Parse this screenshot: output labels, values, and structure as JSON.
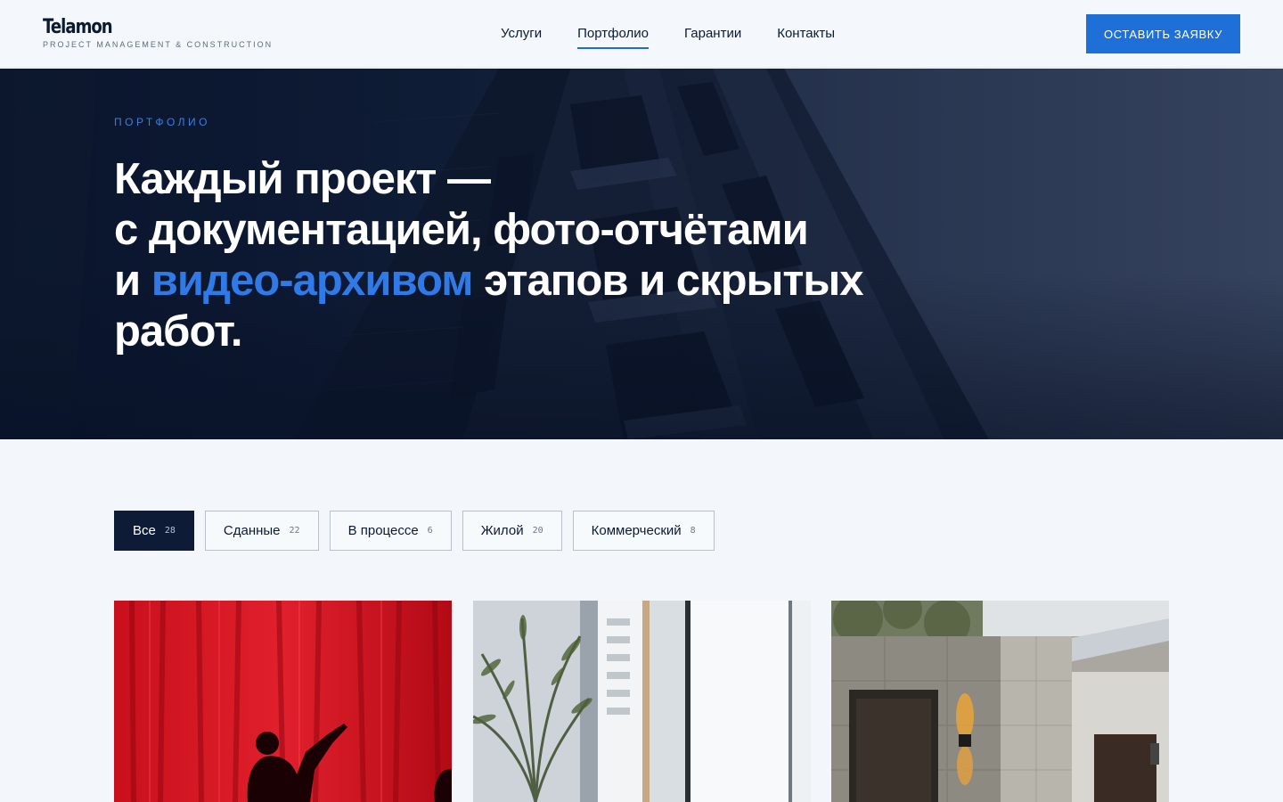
{
  "brand": {
    "name": "Telamon",
    "tagline": "PROJECT MANAGEMENT & CONSTRUCTION"
  },
  "nav": {
    "items": [
      {
        "label": "Услуги",
        "active": false
      },
      {
        "label": "Портфолио",
        "active": true
      },
      {
        "label": "Гарантии",
        "active": false
      },
      {
        "label": "Контакты",
        "active": false
      }
    ],
    "cta_label": "ОСТАВИТЬ ЗАЯВКУ"
  },
  "hero": {
    "eyebrow": "ПОРТФОЛИО",
    "title_line1": "Каждый проект —",
    "title_line2": "с документацией, фото-отчётами",
    "title_line3_start": "и ",
    "title_accent": "видео-архивом",
    "title_line3_end": " этапов и скрытых",
    "title_line4": "работ."
  },
  "filters": [
    {
      "label": "Все",
      "count": "28",
      "active": true
    },
    {
      "label": "Сданные",
      "count": "22",
      "active": false
    },
    {
      "label": "В процессе",
      "count": "6",
      "active": false
    },
    {
      "label": "Жилой",
      "count": "20",
      "active": false
    },
    {
      "label": "Коммерческий",
      "count": "8",
      "active": false
    }
  ],
  "colors": {
    "accent": "#1f6fd8",
    "dark_navy": "#0d1b36",
    "page_background": "#f3f7fb"
  },
  "cards": [
    {
      "image": "red-curtain-photo"
    },
    {
      "image": "window-plant-interior-photo"
    },
    {
      "image": "stone-facade-entrance-photo"
    }
  ]
}
